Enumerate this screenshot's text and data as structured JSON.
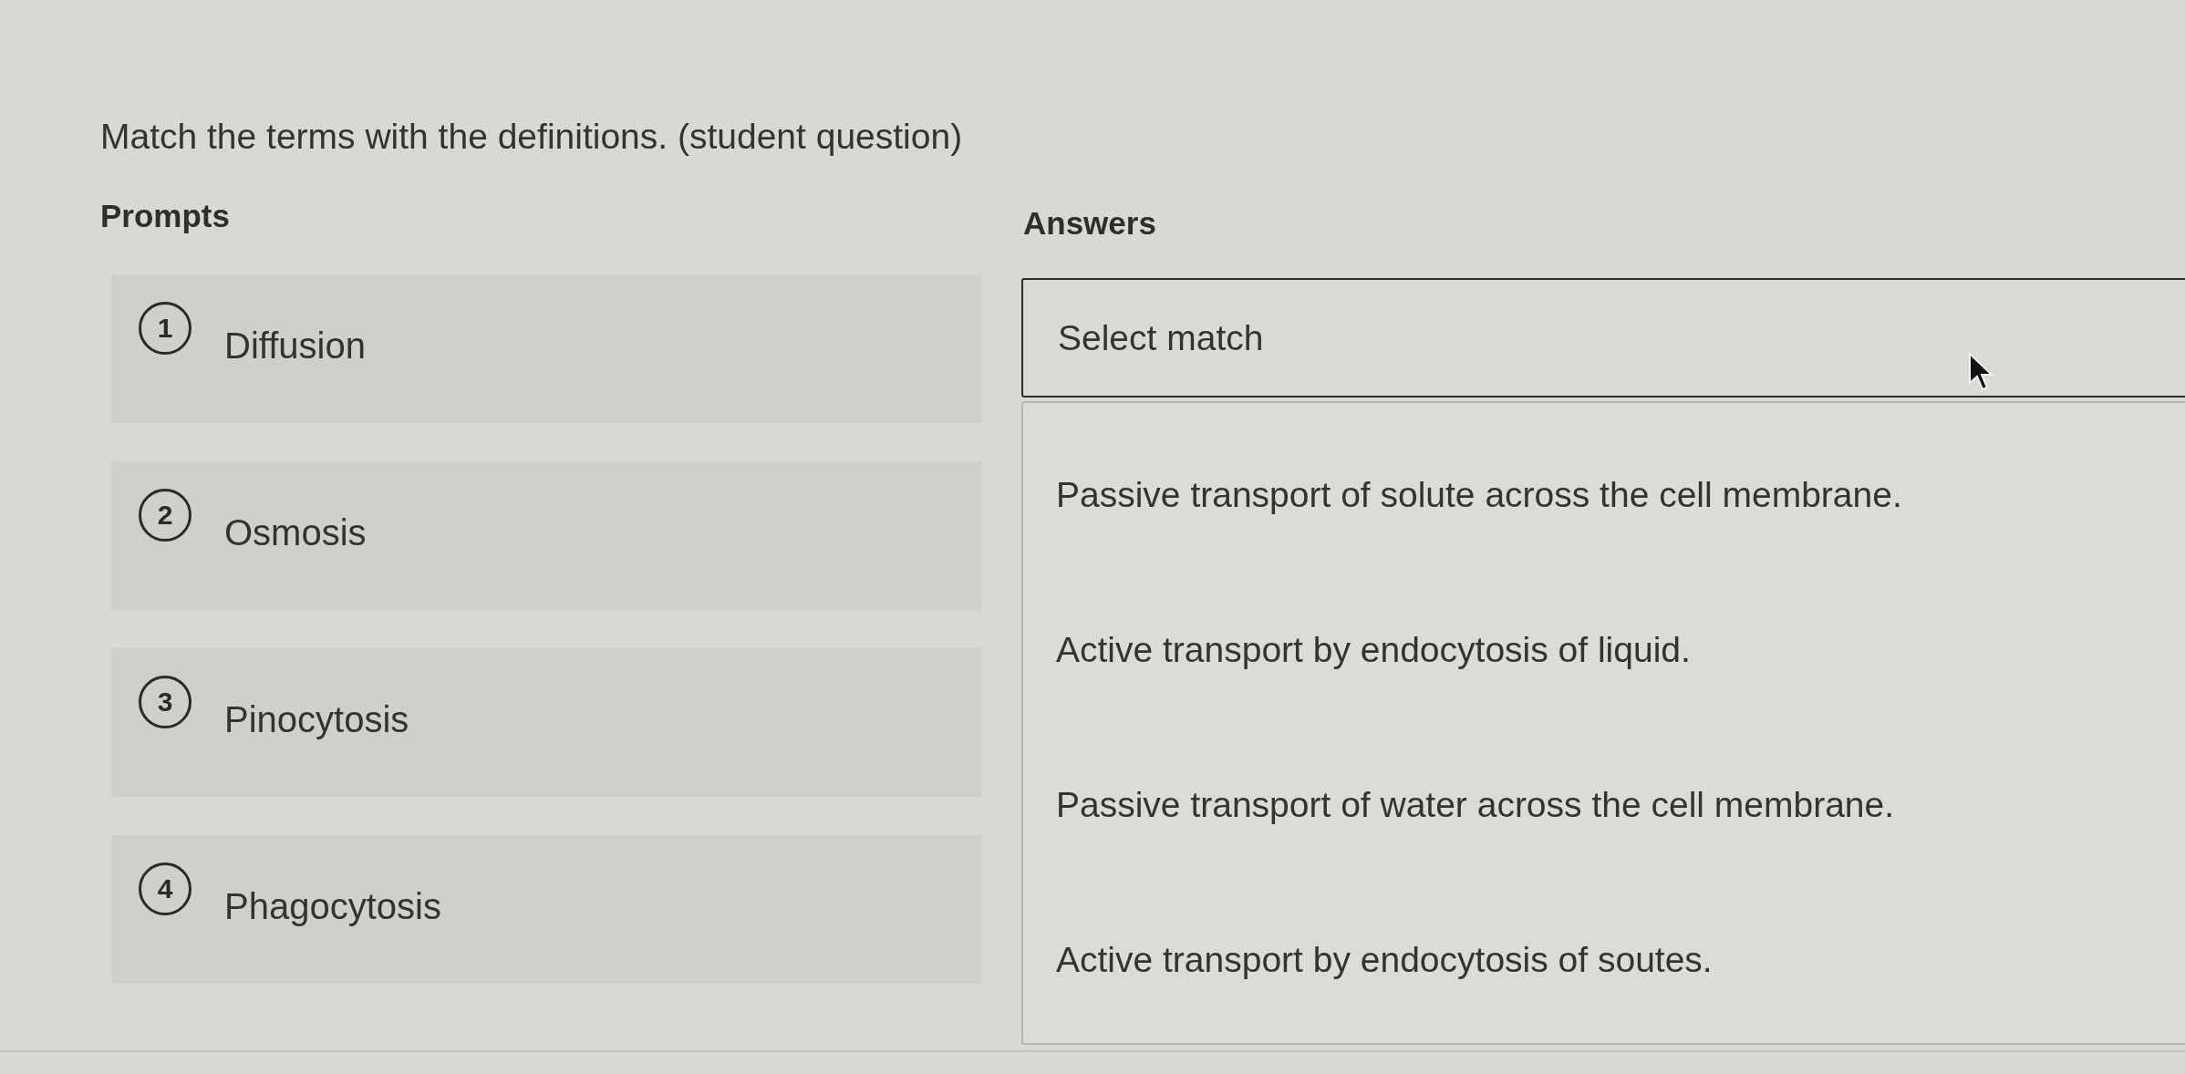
{
  "question": {
    "instructions": "Match the terms with the definitions. (student question)"
  },
  "prompts": {
    "heading": "Prompts",
    "items": [
      {
        "number": "1",
        "term": "Diffusion"
      },
      {
        "number": "2",
        "term": "Osmosis"
      },
      {
        "number": "3",
        "term": "Pinocytosis"
      },
      {
        "number": "4",
        "term": "Phagocytosis"
      }
    ]
  },
  "answers": {
    "heading": "Answers",
    "select": {
      "placeholder": "Select match",
      "expanded": true
    },
    "options": [
      {
        "text": "Passive transport of solute across the cell membrane.",
        "selected": false
      },
      {
        "text": "Active transport by endocytosis of liquid.",
        "selected": false
      },
      {
        "text": "Passive transport of water across the cell membrane.",
        "selected": false
      },
      {
        "text": "Active transport by endocytosis of soutes.",
        "selected": false
      }
    ]
  }
}
